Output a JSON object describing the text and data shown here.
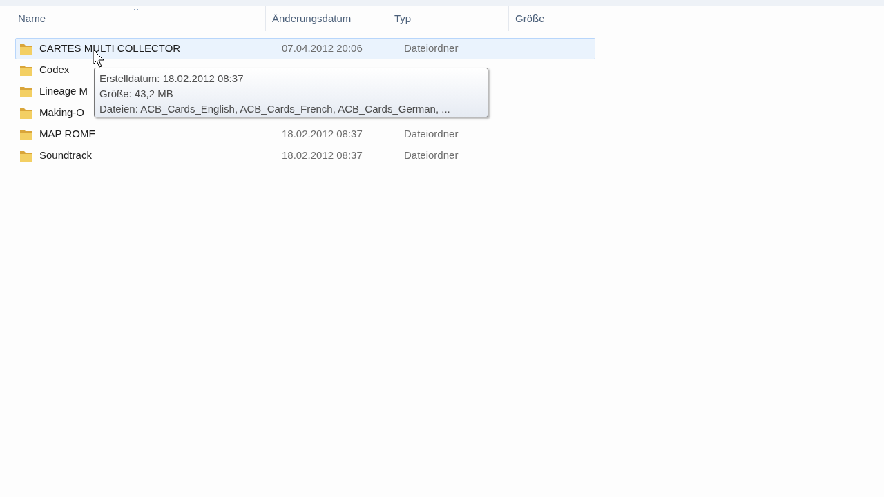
{
  "columns": [
    {
      "label": "Name",
      "sorted": true
    },
    {
      "label": "Änderungsdatum",
      "sorted": false
    },
    {
      "label": "Typ",
      "sorted": false
    },
    {
      "label": "Größe",
      "sorted": false
    }
  ],
  "rows": [
    {
      "name": "CARTES MULTI COLLECTOR",
      "date": "07.04.2012 20:06",
      "type": "Dateiordner",
      "selected": true
    },
    {
      "name": "Codex",
      "selected": false
    },
    {
      "name": "Lineage M",
      "selected": false
    },
    {
      "name": "Making-O",
      "selected": false
    },
    {
      "name": "MAP ROME",
      "date": "18.02.2012 08:37",
      "type": "Dateiordner",
      "selected": false
    },
    {
      "name": "Soundtrack",
      "date": "18.02.2012 08:37",
      "type": "Dateiordner",
      "selected": false
    }
  ],
  "tooltip": {
    "lines": [
      "Erstelldatum: 18.02.2012 08:37",
      "Größe: 43,2 MB",
      "Dateien: ACB_Cards_English, ACB_Cards_French, ACB_Cards_German, ..."
    ]
  }
}
